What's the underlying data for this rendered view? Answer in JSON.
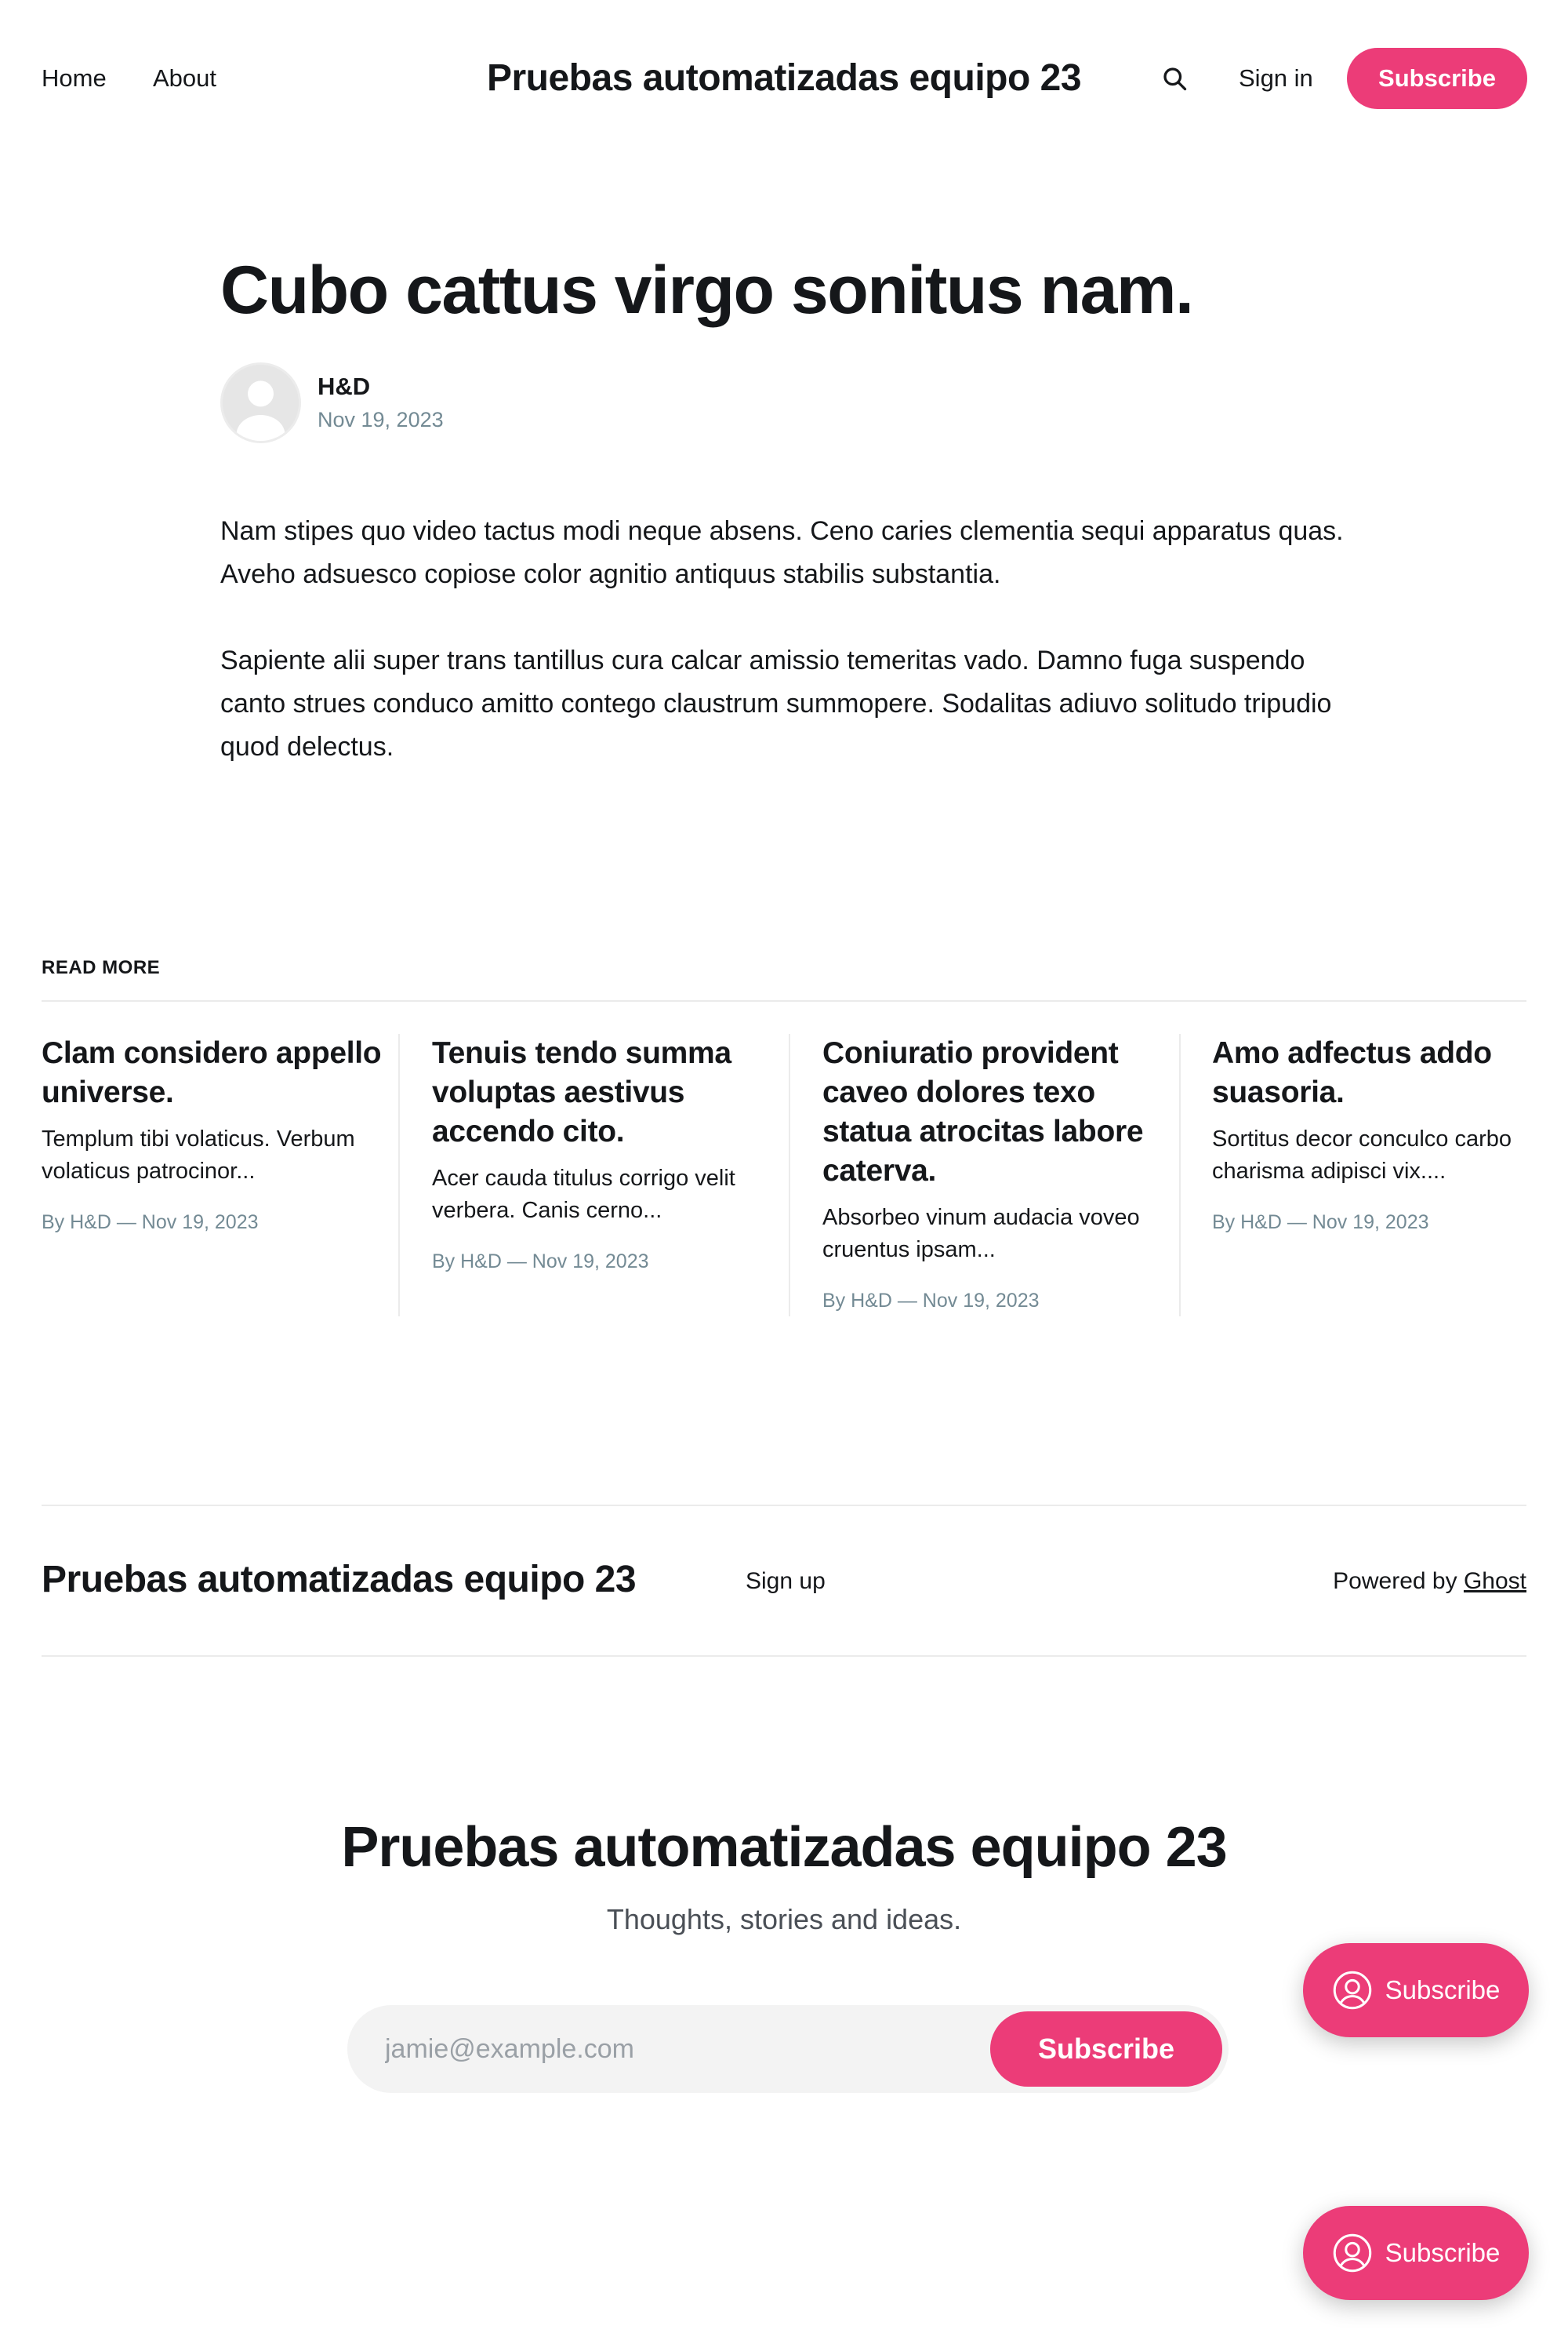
{
  "header": {
    "nav": [
      {
        "label": "Home"
      },
      {
        "label": "About"
      }
    ],
    "site_title": "Pruebas automatizadas equipo 23",
    "search_icon": "search-icon",
    "signin_label": "Sign in",
    "subscribe_label": "Subscribe"
  },
  "colors": {
    "accent": "#ec3c78",
    "text": "#15171a",
    "muted": "#738a94"
  },
  "article": {
    "title": "Cubo cattus virgo sonitus nam.",
    "author": "H&D",
    "date": "Nov 19, 2023",
    "paragraphs": [
      "Nam stipes quo video tactus modi neque absens. Ceno caries clementia sequi apparatus quas. Aveho adsuesco copiose color agnitio antiquus stabilis substantia.",
      "Sapiente alii super trans tantillus cura calcar amissio temeritas vado. Damno fuga suspendo canto strues conduco amitto contego claustrum summopere. Sodalitas adiuvo solitudo tripudio quod delectus."
    ]
  },
  "read_more": {
    "label": "READ MORE",
    "cards": [
      {
        "title": "Clam considero appello universe.",
        "excerpt": "Templum tibi volaticus. Verbum volaticus patrocinor...",
        "meta": "By H&D — Nov 19, 2023"
      },
      {
        "title": "Tenuis tendo summa voluptas aestivus accendo cito.",
        "excerpt": "Acer cauda titulus corrigo velit verbera. Canis cerno...",
        "meta": "By H&D — Nov 19, 2023"
      },
      {
        "title": "Coniuratio provident caveo dolores texo statua atrocitas labore caterva.",
        "excerpt": "Absorbeo vinum audacia voveo cruentus ipsam...",
        "meta": "By H&D — Nov 19, 2023"
      },
      {
        "title": "Amo adfectus addo suasoria.",
        "excerpt": "Sortitus decor conculco carbo charisma adipisci vix....",
        "meta": "By H&D — Nov 19, 2023"
      }
    ]
  },
  "footer": {
    "site_title": "Pruebas automatizadas equipo 23",
    "signup_label": "Sign up",
    "powered_prefix": "Powered by",
    "powered_link": "Ghost"
  },
  "cta": {
    "title": "Pruebas automatizadas equipo 23",
    "subtitle": "Thoughts, stories and ideas.",
    "email_placeholder": "jamie@example.com",
    "button_label": "Subscribe"
  },
  "portal": {
    "button_label": "Subscribe",
    "icon": "user-circle-icon"
  }
}
